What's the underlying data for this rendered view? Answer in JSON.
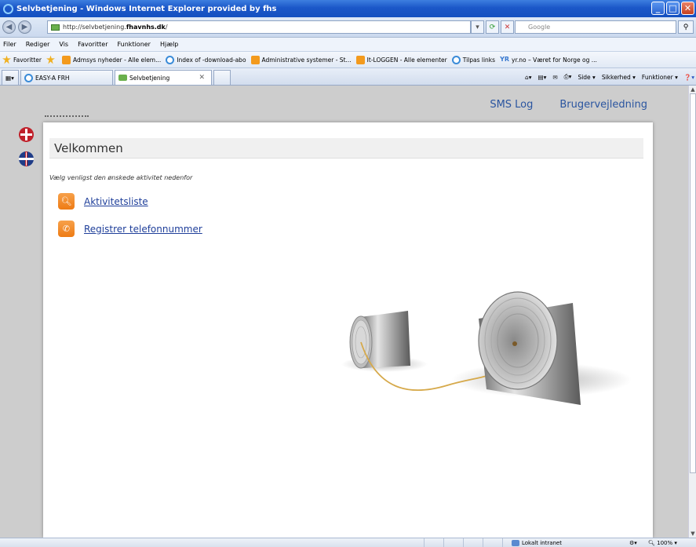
{
  "window": {
    "title": "Selvbetjening - Windows Internet Explorer provided by fhs",
    "controls": [
      "minimize",
      "maximize",
      "close"
    ]
  },
  "address": {
    "url_prefix": "http://selvbetjening.",
    "url_domain": "fhavnhs.dk",
    "url_suffix": "/",
    "search_placeholder": "Google"
  },
  "menu": [
    "Filer",
    "Rediger",
    "Vis",
    "Favoritter",
    "Funktioner",
    "Hjælp"
  ],
  "favorites": {
    "label": "Favoritter",
    "items": [
      {
        "label": "Admsys nyheder - Alle elem...",
        "icon": "orange"
      },
      {
        "label": "Index of -download-abo",
        "icon": "ie"
      },
      {
        "label": "Administrative systemer - St...",
        "icon": "orange"
      },
      {
        "label": "It-LOGGEN - Alle elementer",
        "icon": "orange"
      },
      {
        "label": "Tilpas links",
        "icon": "ie"
      },
      {
        "label": "yr.no – Været for Norge og ...",
        "icon": "yr"
      }
    ]
  },
  "tabs": [
    {
      "label": "EASY-A FRH"
    },
    {
      "label": "Selvbetjening"
    }
  ],
  "commands": [
    "Side ▾",
    "Sikkerhed ▾",
    "Funktioner ▾"
  ],
  "page": {
    "nav": [
      "SMS Log",
      "Brugervejledning"
    ],
    "heading": "Velkommen",
    "subtitle": "Vælg venligst den ønskede aktivitet nedenfor",
    "actions": [
      {
        "label": "Aktivitetsliste",
        "icon": "search-icon"
      },
      {
        "label": "Registrer telefonnummer",
        "icon": "phone-icon"
      }
    ]
  },
  "status": {
    "zone": "Lokalt intranet",
    "zoom": "100%"
  }
}
